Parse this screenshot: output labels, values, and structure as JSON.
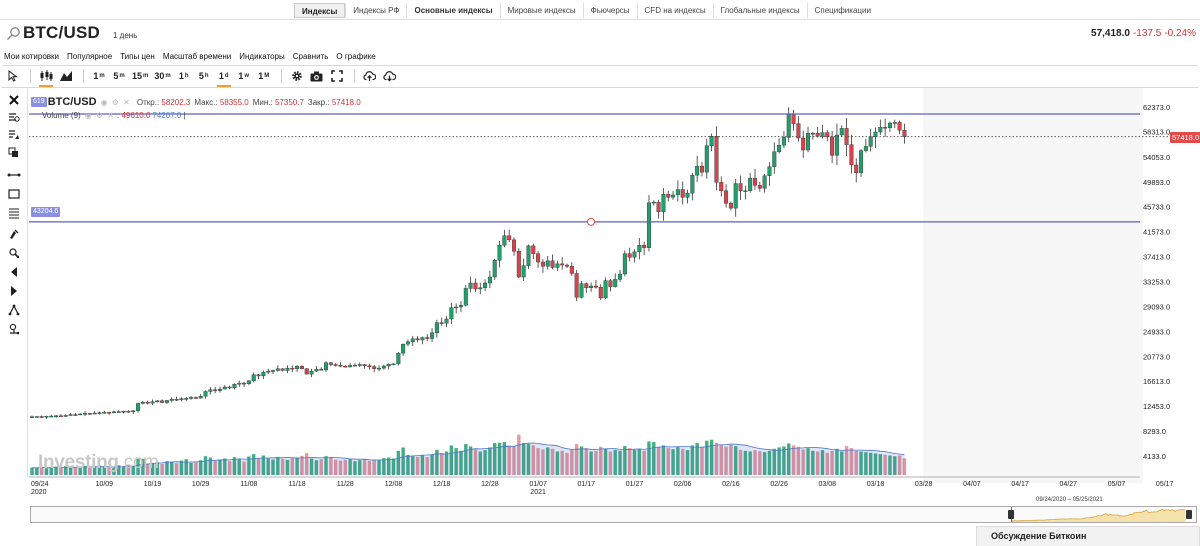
{
  "top_tabs": [
    {
      "label": "Индексы",
      "active": true
    },
    {
      "label": "Индексы РФ",
      "active": false
    },
    {
      "label": "Основные индексы",
      "active": false,
      "bold": true
    },
    {
      "label": "Мировые индексы",
      "active": false
    },
    {
      "label": "Фьючерсы",
      "active": false
    },
    {
      "label": "CFD на индексы",
      "active": false
    },
    {
      "label": "Глобальные индексы",
      "active": false
    },
    {
      "label": "Спецификации",
      "active": false
    }
  ],
  "header": {
    "symbol": "BTC/USD",
    "period": "1 день",
    "price": "57,418.0",
    "change": "-137.5",
    "change_pct": "-0.24%"
  },
  "menu": [
    "Мои котировки",
    "Популярное",
    "Типы цен",
    "Масштаб времени",
    "Индикаторы",
    "Сравнить",
    "О графике"
  ],
  "toolbar": {
    "timeframes": [
      {
        "label": "1m",
        "selected": false
      },
      {
        "label": "5m",
        "selected": false
      },
      {
        "label": "15m",
        "selected": false
      },
      {
        "label": "30m",
        "selected": false
      },
      {
        "label": "1h",
        "selected": false
      },
      {
        "label": "5h",
        "selected": false
      },
      {
        "label": "1d",
        "selected": true
      },
      {
        "label": "1w",
        "selected": false
      },
      {
        "label": "1M",
        "selected": false
      }
    ]
  },
  "left_tools": [
    "close-icon",
    "crosshair-icon",
    "magnet-icon",
    "copy-icon",
    "horizontal-ray-icon",
    "rectangle-icon",
    "fib-lines-icon",
    "brush-icon",
    "path-icon",
    "trend-down-icon",
    "trend-up-icon",
    "pitchfork-icon",
    "text-tool-icon"
  ],
  "legend": {
    "badge": "619",
    "symbol": "BTC/USD",
    "open_label": "Откр.:",
    "open": "58202.3",
    "high_label": "Макс.:",
    "high": "58355.0",
    "low_label": "Мин.:",
    "low": "57350.7",
    "close_label": "Закр.:",
    "close": "57418.0",
    "volume_label": "Volume (9)",
    "volume_value": "49610.0",
    "volume_ma": "74207.0"
  },
  "hline_badge": "43204.6",
  "last_price_tag": "57418.0",
  "watermark": {
    "brand": "Investing",
    "suffix": ".com"
  },
  "colors": {
    "up": "#22a06b",
    "down": "#d9434b",
    "hline": "#5b5fc7",
    "price": "#d63131"
  },
  "navigator_range": "09/24/2020 – 05/25/2021",
  "discussion_label": "Обсуждение Биткоин",
  "chart_data": {
    "type": "candlestick",
    "y_ticks": [
      "62373.0",
      "58313.0",
      "54053.0",
      "49893.0",
      "45733.0",
      "41573.0",
      "37413.0",
      "33253.0",
      "29093.0",
      "24933.0",
      "20773.0",
      "16613.0",
      "12453.0",
      "8293.0",
      "4133.0"
    ],
    "x_ticks": [
      {
        "label": "09/24",
        "sub": "2020"
      },
      {
        "label": "10/09",
        "sub": ""
      },
      {
        "label": "10/19",
        "sub": ""
      },
      {
        "label": "10/29",
        "sub": ""
      },
      {
        "label": "11/08",
        "sub": ""
      },
      {
        "label": "11/18",
        "sub": ""
      },
      {
        "label": "11/28",
        "sub": ""
      },
      {
        "label": "12/08",
        "sub": ""
      },
      {
        "label": "12/18",
        "sub": ""
      },
      {
        "label": "12/28",
        "sub": ""
      },
      {
        "label": "01/07",
        "sub": "2021"
      },
      {
        "label": "01/17",
        "sub": ""
      },
      {
        "label": "01/27",
        "sub": ""
      },
      {
        "label": "02/06",
        "sub": ""
      },
      {
        "label": "02/16",
        "sub": ""
      },
      {
        "label": "02/26",
        "sub": ""
      },
      {
        "label": "03/08",
        "sub": ""
      },
      {
        "label": "03/18",
        "sub": ""
      },
      {
        "label": "03/28",
        "sub": ""
      },
      {
        "label": "04/07",
        "sub": ""
      },
      {
        "label": "04/17",
        "sub": ""
      },
      {
        "label": "04/27",
        "sub": ""
      },
      {
        "label": "05/07",
        "sub": ""
      },
      {
        "label": "05/17",
        "sub": ""
      }
    ],
    "horizontal_lines": [
      61200,
      43204.6
    ],
    "last_price": 57418.0,
    "close_series": [
      10700,
      10720,
      10650,
      10780,
      10800,
      10850,
      10760,
      10900,
      11050,
      11000,
      11150,
      11250,
      11200,
      11300,
      11350,
      11420,
      11380,
      11500,
      11550,
      11600,
      11520,
      11700,
      12900,
      13100,
      12950,
      13200,
      13350,
      13050,
      13400,
      13600,
      13500,
      13700,
      13750,
      13900,
      13800,
      14100,
      14900,
      15200,
      15050,
      15300,
      15650,
      15500,
      16100,
      16300,
      16200,
      16700,
      17700,
      17500,
      18100,
      18300,
      18400,
      18700,
      18400,
      18800,
      18700,
      19100,
      18700,
      17800,
      18300,
      18600,
      18500,
      19700,
      19400,
      19300,
      19100,
      19000,
      19250,
      19300,
      19400,
      19200,
      19050,
      18700,
      18800,
      19150,
      19450,
      19500,
      21300,
      22800,
      23200,
      23700,
      23500,
      23900,
      23750,
      24700,
      26400,
      26300,
      27000,
      28900,
      29000,
      29300,
      32100,
      33000,
      32000,
      32200,
      33000,
      34000,
      36800,
      39300,
      40900,
      40200,
      38300,
      34000,
      35900,
      39200,
      37900,
      36500,
      35800,
      36700,
      35600,
      36200,
      36000,
      35800,
      34600,
      30600,
      32900,
      32200,
      32500,
      32300,
      30500,
      33400,
      32400,
      33600,
      34500,
      37900,
      37300,
      38200,
      39300,
      38900,
      46400,
      46500,
      44900,
      47800,
      47300,
      47700,
      48600,
      47300,
      48000,
      51000,
      52500,
      51500,
      55900,
      57500,
      49800,
      48400,
      46300,
      45500,
      49600,
      48400,
      48400,
      50500,
      49300,
      48800,
      50900,
      52400,
      54900,
      56000,
      57300,
      61200,
      59600,
      57200,
      55200,
      58000,
      58000,
      57500,
      58100,
      57400,
      54300,
      57700,
      58800,
      56100,
      52700,
      51400,
      55100,
      55800,
      57400,
      58200,
      59000,
      58900,
      59700,
      59800,
      58500,
      57418
    ],
    "volume_series": [
      22000,
      21000,
      24000,
      20000,
      23000,
      25000,
      22000,
      26000,
      24000,
      21000,
      25000,
      27000,
      23000,
      26000,
      28000,
      24000,
      22000,
      26000,
      29000,
      25000,
      31000,
      27000,
      52000,
      48000,
      34000,
      36000,
      38000,
      33000,
      41000,
      39000,
      35000,
      43000,
      47000,
      36000,
      38000,
      44000,
      56000,
      52000,
      42000,
      46000,
      49000,
      41000,
      53000,
      47000,
      40000,
      55000,
      62000,
      51000,
      58000,
      49000,
      46000,
      54000,
      48000,
      45000,
      50000,
      52000,
      57000,
      65000,
      49000,
      44000,
      47000,
      56000,
      52000,
      46000,
      43000,
      45000,
      48000,
      41000,
      44000,
      47000,
      42000,
      46000,
      45000,
      50000,
      52000,
      49000,
      72000,
      82000,
      60000,
      56000,
      54000,
      58000,
      53000,
      61000,
      75000,
      66000,
      70000,
      88000,
      80000,
      72000,
      92000,
      85000,
      76000,
      70000,
      74000,
      82000,
      95000,
      96000,
      98000,
      88000,
      86000,
      120000,
      95000,
      92000,
      88000,
      80000,
      76000,
      82000,
      78000,
      70000,
      72000,
      66000,
      75000,
      92000,
      85000,
      80000,
      70000,
      72000,
      84000,
      78000,
      70000,
      75000,
      72000,
      86000,
      80000,
      75000,
      78000,
      72000,
      100000,
      98000,
      84000,
      88000,
      80000,
      77000,
      83000,
      78000,
      74000,
      88000,
      95000,
      82000,
      102000,
      105000,
      96000,
      88000,
      84000,
      90000,
      86000,
      75000,
      72000,
      70000,
      74000,
      71000,
      68000,
      72000,
      78000,
      82000,
      85000,
      94000,
      88000,
      84000,
      76000,
      80000,
      72000,
      70000,
      74000,
      66000,
      72000,
      78000,
      70000,
      86000,
      80000,
      72000,
      70000,
      68000,
      66000,
      64000,
      62000,
      60000,
      58000,
      56000,
      58000,
      49610
    ]
  }
}
